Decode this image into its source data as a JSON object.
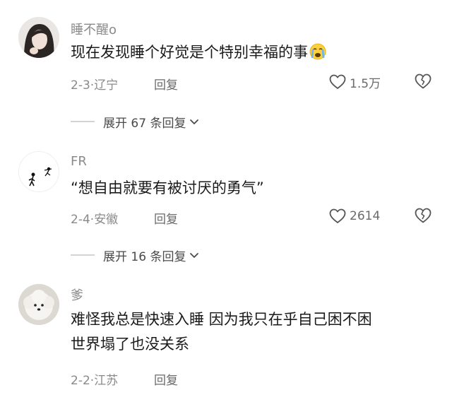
{
  "comments": [
    {
      "username": "睡不醒o",
      "text": "现在发现睡个好觉是个特别幸福的事",
      "emoji": "crying-face-emoji",
      "date": "2-3",
      "location": "辽宁",
      "reply_label": "回复",
      "likes": "1.5万",
      "expand_label": "展开 67 条回复"
    },
    {
      "username": "FR",
      "text": "“想自由就要有被讨厌的勇气”",
      "date": "2-4",
      "location": "安徽",
      "reply_label": "回复",
      "likes": "2614",
      "expand_label": "展开 16 条回复"
    },
    {
      "username": "爹",
      "text_line1": "难怪我总是快速入睡 因为我只在乎自己困不困",
      "text_line2": "世界塌了也没关系",
      "date": "2-2",
      "location": "江苏",
      "reply_label": "回复"
    }
  ],
  "separator": "·",
  "colors": {
    "text": "#1a1a1a",
    "muted": "#8a8a8a",
    "line": "#d3d3d3"
  }
}
